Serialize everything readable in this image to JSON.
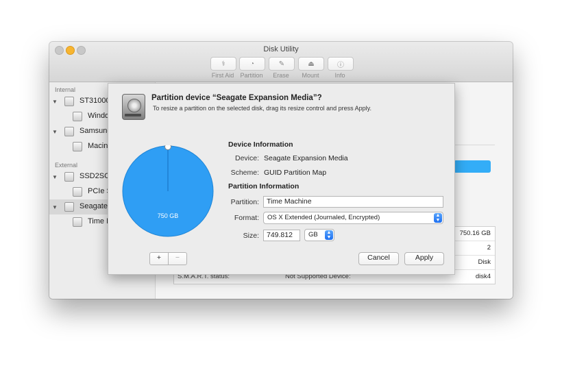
{
  "window": {
    "title": "Disk Utility",
    "toolbar": [
      {
        "label": "First Aid",
        "icon": "stethoscope-icon",
        "glyph": "⚕"
      },
      {
        "label": "Partition",
        "icon": "partition-icon",
        "glyph": "◔"
      },
      {
        "label": "Erase",
        "icon": "erase-icon",
        "glyph": "✎"
      },
      {
        "label": "Mount",
        "icon": "mount-icon",
        "glyph": "⏏"
      },
      {
        "label": "Info",
        "icon": "info-icon",
        "glyph": "ⓘ"
      }
    ]
  },
  "sidebar": {
    "internal_header": "Internal",
    "external_header": "External",
    "items": [
      {
        "label": "ST31000"
      },
      {
        "label": "Windo"
      },
      {
        "label": "Samsung"
      },
      {
        "label": "Macin"
      },
      {
        "label": "SSD2SC"
      },
      {
        "label": "PCIe S"
      },
      {
        "label": "Seagate"
      },
      {
        "label": "Time M"
      }
    ]
  },
  "info_table": {
    "rows": [
      {
        "value": "750.16 GB"
      },
      {
        "value": "2"
      },
      {
        "value": "Disk"
      },
      {
        "label": "S.M.A.R.T. status:",
        "mid": "Not Supported   Device:",
        "value": "disk4"
      }
    ]
  },
  "dialog": {
    "title": "Partition device “Seagate Expansion Media”?",
    "subtitle": "To resize a partition on the selected disk, drag its resize control and press Apply.",
    "pie_label": "750 GB",
    "pie_color": "#2f9ef4",
    "device_info_header": "Device Information",
    "device_label": "Device:",
    "device_value": "Seagate Expansion Media",
    "scheme_label": "Scheme:",
    "scheme_value": "GUID Partition Map",
    "partition_info_header": "Partition Information",
    "partition_label": "Partition:",
    "partition_value": "Time Machine",
    "format_label": "Format:",
    "format_value": "OS X Extended (Journaled, Encrypted)",
    "size_label": "Size:",
    "size_value": "749.812",
    "size_unit": "GB",
    "add_label": "+",
    "remove_label": "−",
    "cancel_label": "Cancel",
    "apply_label": "Apply"
  }
}
